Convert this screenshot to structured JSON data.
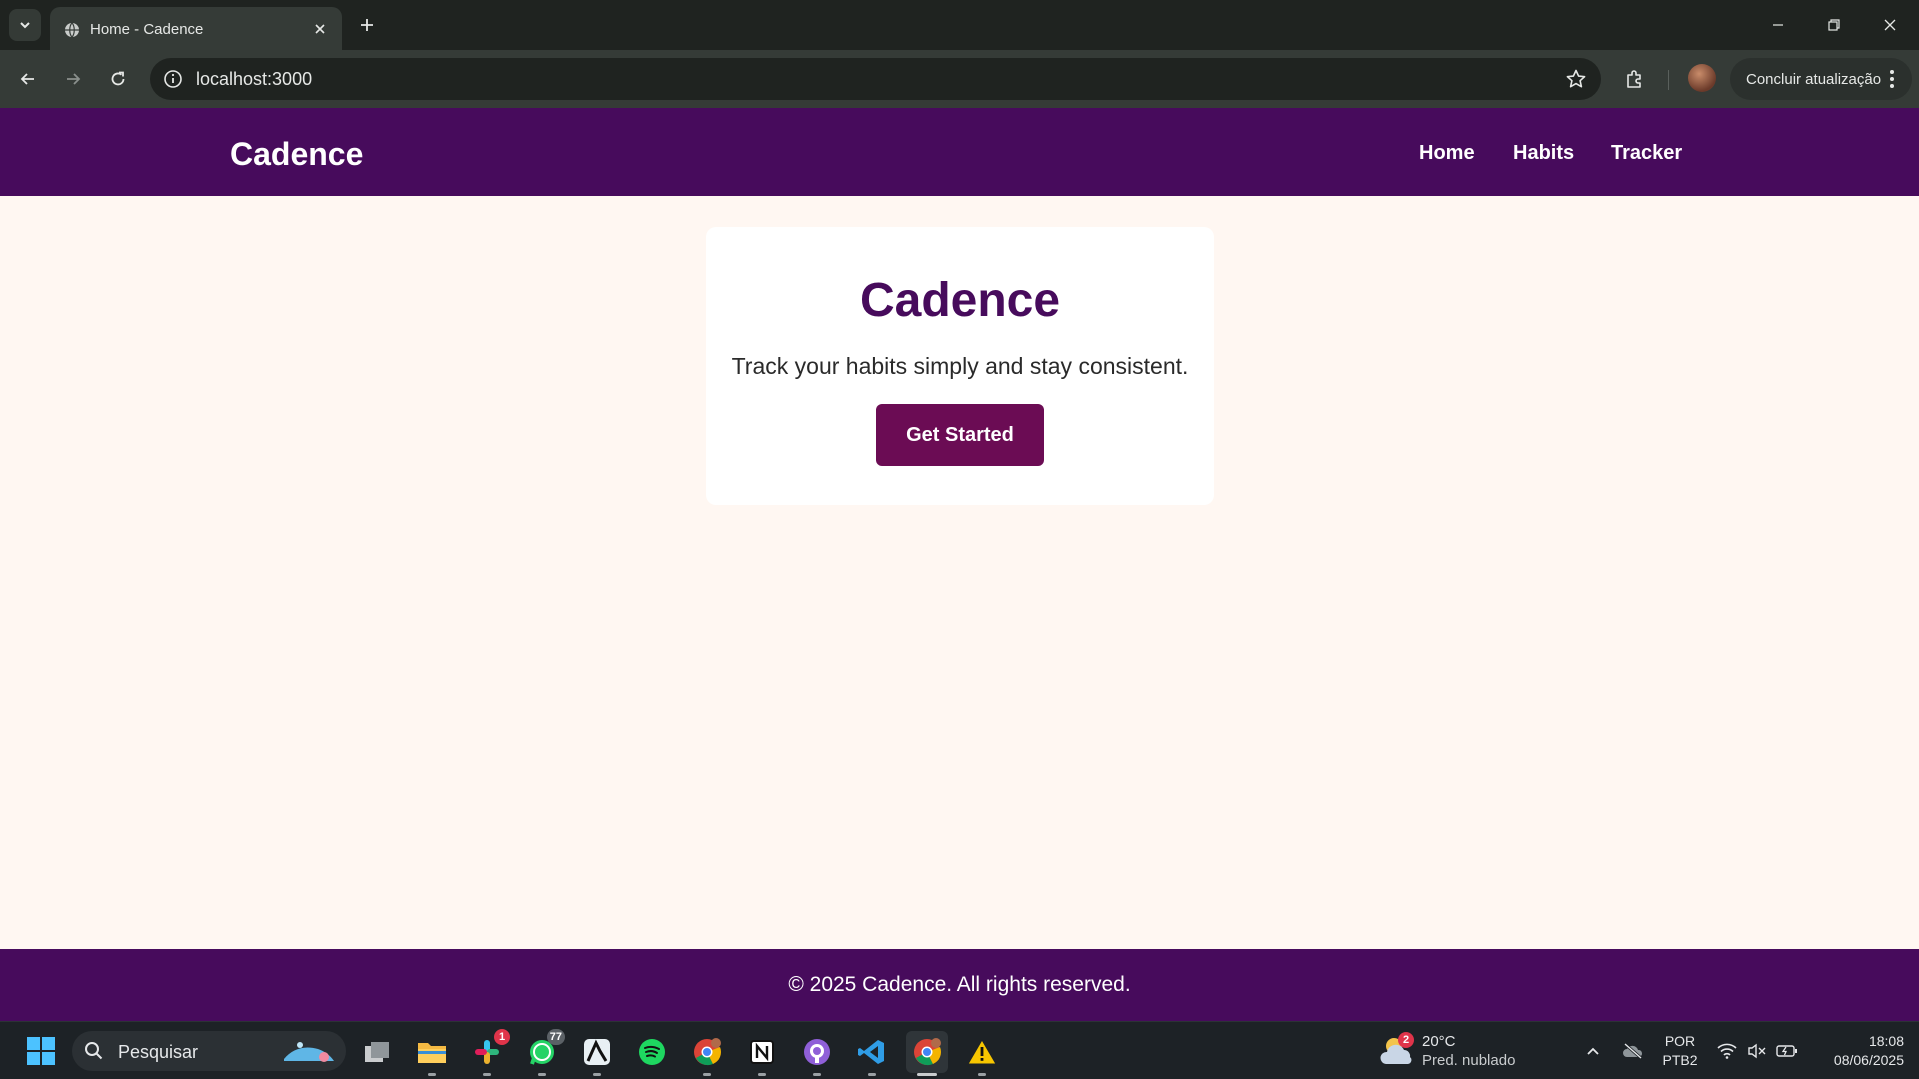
{
  "browser": {
    "tab_title": "Home - Cadence",
    "url": "localhost:3000",
    "update_label": "Concluir atualização"
  },
  "site": {
    "brand": "Cadence",
    "nav": [
      "Home",
      "Habits",
      "Tracker"
    ],
    "hero": {
      "title": "Cadence",
      "subtitle": "Track your habits simply and stay consistent.",
      "cta": "Get Started"
    },
    "footer": "© 2025 Cadence. All rights reserved.",
    "colors": {
      "primary": "#470b5c",
      "button": "#6b0c54",
      "background": "#fff7f2"
    }
  },
  "taskbar": {
    "search_placeholder": "Pesquisar",
    "apps": [
      {
        "name": "task-view-icon"
      },
      {
        "name": "file-explorer-icon"
      },
      {
        "name": "slack-icon",
        "badge": "1"
      },
      {
        "name": "whatsapp-icon",
        "badge": "77"
      },
      {
        "name": "capcut-icon"
      },
      {
        "name": "spotify-icon"
      },
      {
        "name": "chrome-profile-icon"
      },
      {
        "name": "notion-icon"
      },
      {
        "name": "github-desktop-icon"
      },
      {
        "name": "vscode-icon"
      },
      {
        "name": "chrome-icon"
      },
      {
        "name": "warning-icon"
      }
    ],
    "weather": {
      "badge": "2",
      "temp": "20°C",
      "desc": "Pred. nublado"
    },
    "lang": {
      "line1": "POR",
      "line2": "PTB2"
    },
    "clock": {
      "time": "18:08",
      "date": "08/06/2025"
    }
  }
}
